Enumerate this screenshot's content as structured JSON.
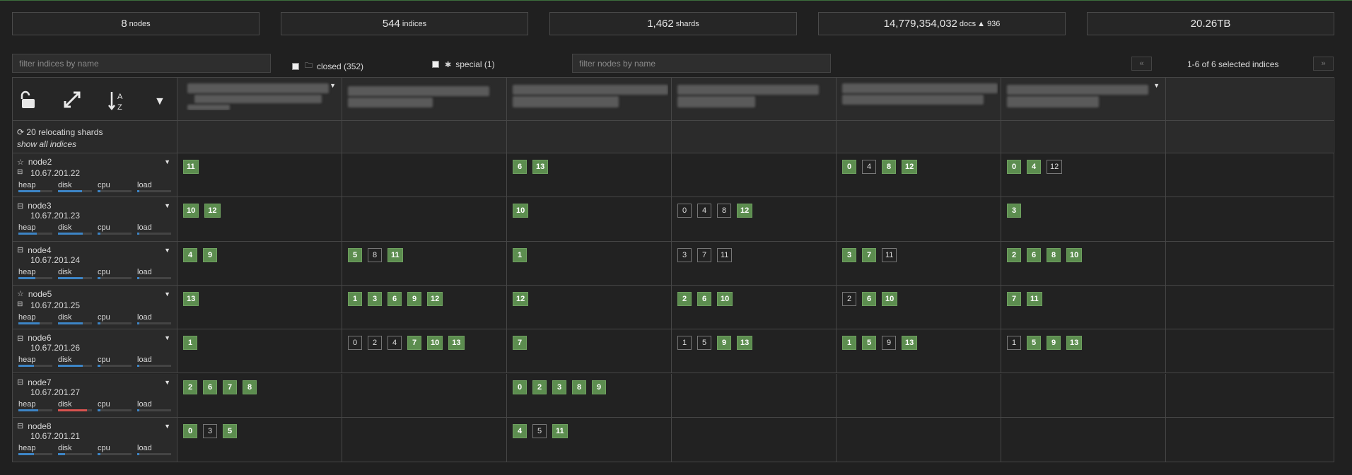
{
  "stats": [
    {
      "value": "8",
      "unit": "nodes"
    },
    {
      "value": "544",
      "unit": "indices"
    },
    {
      "value": "1,462",
      "unit": "shards"
    },
    {
      "value": "14,779,354,032",
      "unit": "docs",
      "extra": "936"
    },
    {
      "value": "20.26TB",
      "unit": ""
    }
  ],
  "filters": {
    "indices_placeholder": "filter indices by name",
    "nodes_placeholder": "filter nodes by name",
    "closed_label": "closed (352)",
    "special_label": "special (1)"
  },
  "pager": {
    "prev": "«",
    "next": "»",
    "info": "1-6 of 6 selected indices"
  },
  "relocating": {
    "label": "20 relocating shards",
    "show_all": "show all indices"
  },
  "metric_labels": {
    "heap": "heap",
    "disk": "disk",
    "cpu": "cpu",
    "load": "load"
  },
  "icons": {
    "lock": "unlock-icon",
    "expand": "expand-icon",
    "sort": "sort-alpha-icon",
    "dropdown": "caret-down-icon",
    "refresh": "refresh-icon",
    "master": "star-icon",
    "data": "hdd-icon"
  },
  "colors": {
    "primary_shard": "#5c8d4f",
    "replica_border": "#777777",
    "metric_bar": "#3d85c6",
    "metric_bar_alert": "#d9534f"
  },
  "nodes": [
    {
      "name": "node2",
      "ip": "10.67.201.22",
      "master": true,
      "metrics": {
        "heap": 0.65,
        "disk": 0.7,
        "cpu": 0.08,
        "load": 0.06
      },
      "shards": [
        [
          {
            "n": "11",
            "p": true
          }
        ],
        [],
        [
          {
            "n": "6",
            "p": true
          },
          {
            "n": "13",
            "p": true
          }
        ],
        [],
        [
          {
            "n": "0",
            "p": true
          },
          {
            "n": "4",
            "p": false
          },
          {
            "n": "8",
            "p": true
          },
          {
            "n": "12",
            "p": true
          }
        ],
        [
          {
            "n": "0",
            "p": true
          },
          {
            "n": "4",
            "p": true
          },
          {
            "n": "12",
            "p": false
          }
        ]
      ]
    },
    {
      "name": "node3",
      "ip": "10.67.201.23",
      "master": false,
      "metrics": {
        "heap": 0.55,
        "disk": 0.72,
        "cpu": 0.08,
        "load": 0.06
      },
      "shards": [
        [
          {
            "n": "10",
            "p": true
          },
          {
            "n": "12",
            "p": true
          }
        ],
        [],
        [
          {
            "n": "10",
            "p": true
          }
        ],
        [
          {
            "n": "0",
            "p": false
          },
          {
            "n": "4",
            "p": false
          },
          {
            "n": "8",
            "p": false
          },
          {
            "n": "12",
            "p": true
          }
        ],
        [],
        [
          {
            "n": "3",
            "p": true
          }
        ]
      ]
    },
    {
      "name": "node4",
      "ip": "10.67.201.24",
      "master": false,
      "metrics": {
        "heap": 0.5,
        "disk": 0.72,
        "cpu": 0.08,
        "load": 0.06
      },
      "shards": [
        [
          {
            "n": "4",
            "p": true
          },
          {
            "n": "9",
            "p": true
          }
        ],
        [
          {
            "n": "5",
            "p": true
          },
          {
            "n": "8",
            "p": false
          },
          {
            "n": "11",
            "p": true
          }
        ],
        [
          {
            "n": "1",
            "p": true
          }
        ],
        [
          {
            "n": "3",
            "p": false
          },
          {
            "n": "7",
            "p": false
          },
          {
            "n": "11",
            "p": false
          }
        ],
        [
          {
            "n": "3",
            "p": true
          },
          {
            "n": "7",
            "p": true
          },
          {
            "n": "11",
            "p": false
          }
        ],
        [
          {
            "n": "2",
            "p": true
          },
          {
            "n": "6",
            "p": true
          },
          {
            "n": "8",
            "p": true
          },
          {
            "n": "10",
            "p": true
          }
        ]
      ]
    },
    {
      "name": "node5",
      "ip": "10.67.201.25",
      "master": true,
      "metrics": {
        "heap": 0.62,
        "disk": 0.72,
        "cpu": 0.08,
        "load": 0.06
      },
      "shards": [
        [
          {
            "n": "13",
            "p": true
          }
        ],
        [
          {
            "n": "1",
            "p": true
          },
          {
            "n": "3",
            "p": true
          },
          {
            "n": "6",
            "p": true
          },
          {
            "n": "9",
            "p": true
          },
          {
            "n": "12",
            "p": true
          }
        ],
        [
          {
            "n": "12",
            "p": true
          }
        ],
        [
          {
            "n": "2",
            "p": true
          },
          {
            "n": "6",
            "p": true
          },
          {
            "n": "10",
            "p": true
          }
        ],
        [
          {
            "n": "2",
            "p": false
          },
          {
            "n": "6",
            "p": true
          },
          {
            "n": "10",
            "p": true
          }
        ],
        [
          {
            "n": "7",
            "p": true
          },
          {
            "n": "11",
            "p": true
          }
        ]
      ]
    },
    {
      "name": "node6",
      "ip": "10.67.201.26",
      "master": false,
      "metrics": {
        "heap": 0.45,
        "disk": 0.72,
        "cpu": 0.08,
        "load": 0.06
      },
      "shards": [
        [
          {
            "n": "1",
            "p": true
          }
        ],
        [
          {
            "n": "0",
            "p": false
          },
          {
            "n": "2",
            "p": false
          },
          {
            "n": "4",
            "p": false
          },
          {
            "n": "7",
            "p": true
          },
          {
            "n": "10",
            "p": true
          },
          {
            "n": "13",
            "p": true
          }
        ],
        [
          {
            "n": "7",
            "p": true
          }
        ],
        [
          {
            "n": "1",
            "p": false
          },
          {
            "n": "5",
            "p": false
          },
          {
            "n": "9",
            "p": true
          },
          {
            "n": "13",
            "p": true
          }
        ],
        [
          {
            "n": "1",
            "p": true
          },
          {
            "n": "5",
            "p": true
          },
          {
            "n": "9",
            "p": false
          },
          {
            "n": "13",
            "p": true
          }
        ],
        [
          {
            "n": "1",
            "p": false
          },
          {
            "n": "5",
            "p": true
          },
          {
            "n": "9",
            "p": true
          },
          {
            "n": "13",
            "p": true
          }
        ]
      ]
    },
    {
      "name": "node7",
      "ip": "10.67.201.27",
      "master": false,
      "metrics": {
        "heap": 0.58,
        "disk": 0.85,
        "cpu": 0.08,
        "load": 0.06,
        "disk_alert": true
      },
      "shards": [
        [
          {
            "n": "2",
            "p": true
          },
          {
            "n": "6",
            "p": true
          },
          {
            "n": "7",
            "p": true
          },
          {
            "n": "8",
            "p": true
          }
        ],
        [],
        [
          {
            "n": "0",
            "p": true
          },
          {
            "n": "2",
            "p": true
          },
          {
            "n": "3",
            "p": true
          },
          {
            "n": "8",
            "p": true
          },
          {
            "n": "9",
            "p": true
          }
        ],
        [],
        [],
        []
      ]
    },
    {
      "name": "node8",
      "ip": "10.67.201.21",
      "master": false,
      "metrics": {
        "heap": 0.45,
        "disk": 0.2,
        "cpu": 0.08,
        "load": 0.06
      },
      "shards": [
        [
          {
            "n": "0",
            "p": true
          },
          {
            "n": "3",
            "p": false
          },
          {
            "n": "5",
            "p": true
          }
        ],
        [],
        [
          {
            "n": "4",
            "p": true
          },
          {
            "n": "5",
            "p": false
          },
          {
            "n": "11",
            "p": true
          }
        ],
        [],
        [],
        []
      ]
    }
  ]
}
